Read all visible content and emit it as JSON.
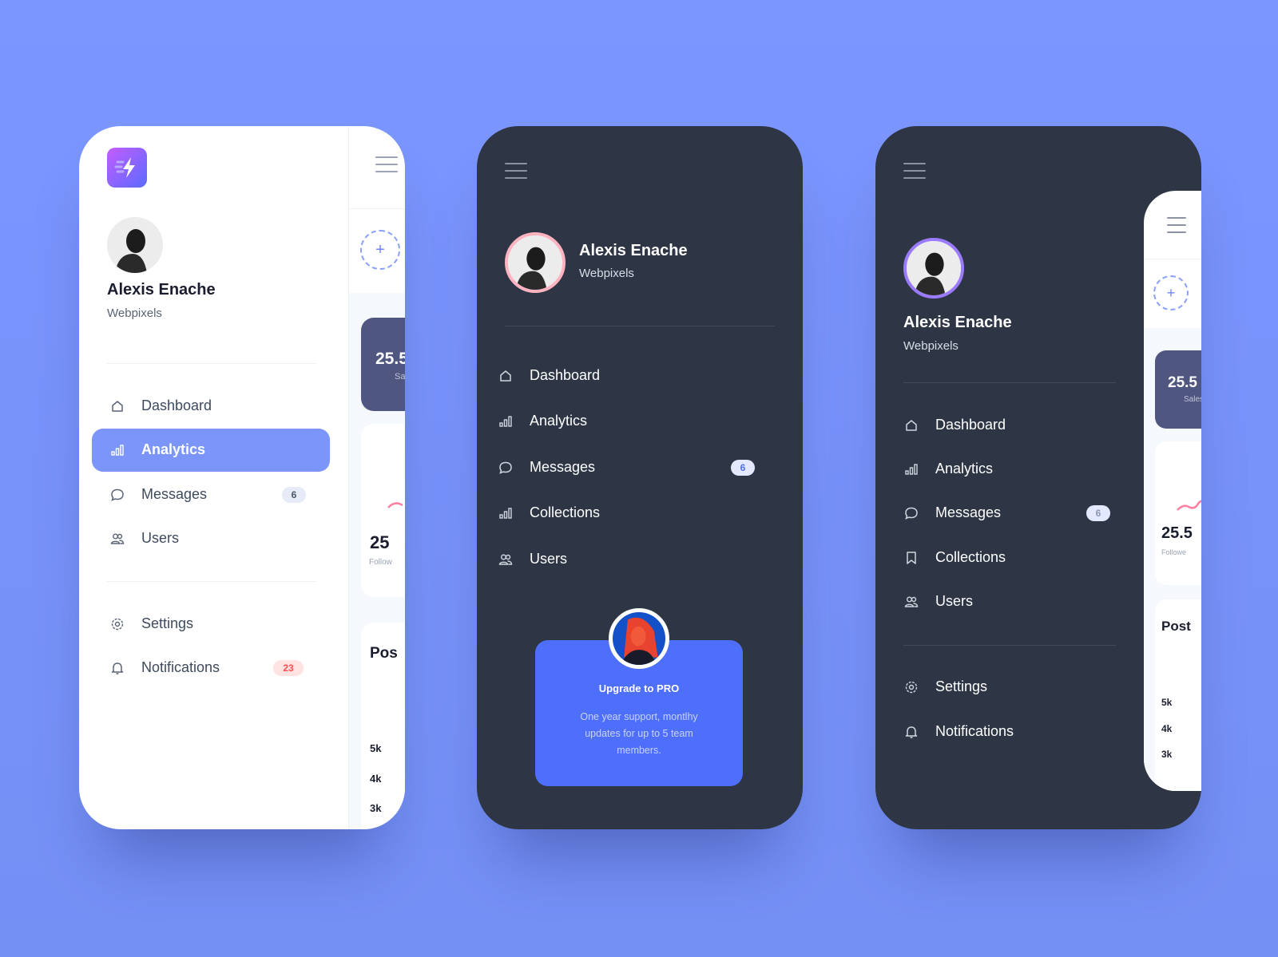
{
  "colors": {
    "background": "#7b96ff",
    "active": "#7b95fb",
    "dark_card": "#2e3645",
    "upgrade": "#4e6ffb",
    "stat_card": "#4f5680",
    "notification_badge": "#ff5a5a"
  },
  "profile": {
    "name": "Alexis Enache",
    "company": "Webpixels"
  },
  "light_sidebar": {
    "nav": [
      {
        "label": "Dashboard",
        "icon": "home-icon"
      },
      {
        "label": "Analytics",
        "icon": "bar-chart-icon",
        "active": true
      },
      {
        "label": "Messages",
        "icon": "chat-icon",
        "badge": "6"
      },
      {
        "label": "Users",
        "icon": "users-icon"
      }
    ],
    "secondary": [
      {
        "label": "Settings",
        "icon": "gear-icon"
      },
      {
        "label": "Notifications",
        "icon": "bell-icon",
        "badge": "23"
      }
    ],
    "preview": {
      "stat1": "25.5",
      "stat1_label": "Sa",
      "stat2": "25",
      "stat2_label": "Follow",
      "chart_title": "Pos",
      "ticks": [
        "5k",
        "4k",
        "3k"
      ]
    }
  },
  "dark_sidebar": {
    "nav": [
      {
        "label": "Dashboard",
        "icon": "home-icon"
      },
      {
        "label": "Analytics",
        "icon": "bar-chart-icon"
      },
      {
        "label": "Messages",
        "icon": "chat-icon",
        "badge": "6"
      },
      {
        "label": "Collections",
        "icon": "bar-chart-icon"
      },
      {
        "label": "Users",
        "icon": "users-icon"
      }
    ],
    "upgrade": {
      "title": "Upgrade to PRO",
      "text": "One year support, montlhy updates for up to 5 team members."
    }
  },
  "dark_sidebar_2": {
    "nav": [
      {
        "label": "Dashboard",
        "icon": "home-icon"
      },
      {
        "label": "Analytics",
        "icon": "bar-chart-icon"
      },
      {
        "label": "Messages",
        "icon": "chat-icon",
        "badge": "6"
      },
      {
        "label": "Collections",
        "icon": "bookmark-icon"
      },
      {
        "label": "Users",
        "icon": "users-icon"
      }
    ],
    "secondary": [
      {
        "label": "Settings",
        "icon": "gear-icon"
      },
      {
        "label": "Notifications",
        "icon": "bell-icon"
      }
    ],
    "preview": {
      "stat1": "25.5",
      "stat1_label": "Sales",
      "stat2": "25.5",
      "stat2_label": "Followe",
      "chart_title": "Post",
      "ticks": [
        "5k",
        "4k",
        "3k"
      ]
    }
  }
}
